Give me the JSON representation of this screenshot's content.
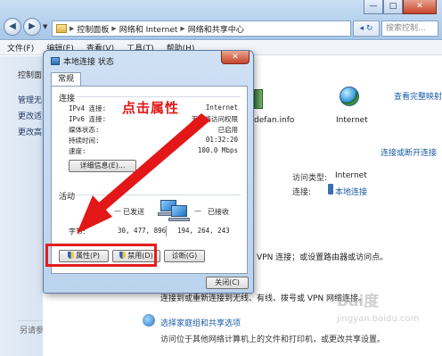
{
  "window": {
    "breadcrumb": [
      "控制面板",
      "网络和 Internet",
      "网络和共享中心"
    ],
    "search_placeholder": "搜索控制...",
    "min": "—",
    "max": "□",
    "close": "✕",
    "refresh_label": "◂ ↻"
  },
  "menu": [
    "文件(F)",
    "编辑(E)",
    "查看(V)",
    "工具(T)",
    "帮助(H)"
  ],
  "leftpane": {
    "items": [
      "控制面",
      "管理无",
      "更改适",
      "更改高"
    ],
    "see_also": "另请参阅"
  },
  "background": {
    "see_full_map": "查看完整映射",
    "computer_name": "defan.info",
    "internet_label": "Internet",
    "connect_or_disconnect": "连接或断开连接",
    "access_type_label": "访问类型:",
    "access_type_value": "Internet",
    "connection_label": "连接:",
    "connection_value": "本地连接",
    "vpn_desc": "VPN 连接；或设置路由器或访问点。",
    "reconnect_desc": "连接到或重新连接到无线、有线、拨号或 VPN 网络连接。",
    "homegroup_link": "选择家庭组和共享选项",
    "homegroup_desc": "访问位于其他网络计算机上的文件和打印机，或更改共享设置。",
    "watermark_top": "Bai度",
    "watermark_bottom": "jingyan.baidu.com"
  },
  "dialog": {
    "title": "本地连接 状态",
    "close": "✕",
    "tab": "常规",
    "connection_group": "连接",
    "rows": [
      {
        "k": "IPv4 连接:",
        "v": "Internet"
      },
      {
        "k": "IPv6 连接:",
        "v": "无网络访问权限"
      },
      {
        "k": "媒体状态:",
        "v": "已启用"
      },
      {
        "k": "持续时间:",
        "v": "01:32:20"
      },
      {
        "k": "速度:",
        "v": "100.0 Mbps"
      }
    ],
    "details_button": "详细信息(E)...",
    "activity_group": "活动",
    "sent_label": "已发送",
    "received_label": "已接收",
    "bytes_label": "字节:",
    "bytes_sent": "30, 477, 896",
    "bytes_received": "194, 264, 243",
    "properties_button": "属性(P)",
    "disable_button": "禁用(D)",
    "diagnose_button": "诊断(G)",
    "close_button": "关闭(C)"
  },
  "annotation": {
    "text": "点击属性",
    "color": "#e31717"
  }
}
